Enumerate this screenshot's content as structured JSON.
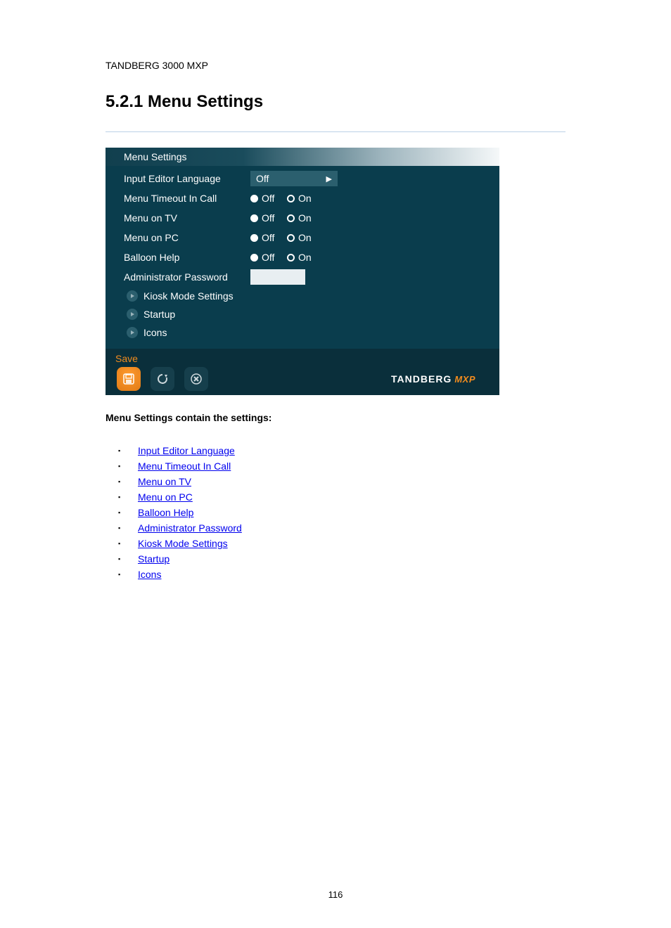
{
  "doc_title": "TANDBERG 3000 MXP",
  "section_heading": "5.2.1 Menu Settings",
  "panel": {
    "title": "Menu Settings",
    "rows": {
      "input_editor": {
        "label": "Input Editor Language",
        "value": "Off"
      },
      "menu_timeout": {
        "label": "Menu Timeout In Call",
        "off": "Off",
        "on": "On"
      },
      "menu_tv": {
        "label": "Menu on TV",
        "off": "Off",
        "on": "On"
      },
      "menu_pc": {
        "label": "Menu on PC",
        "off": "Off",
        "on": "On"
      },
      "balloon": {
        "label": "Balloon Help",
        "off": "Off",
        "on": "On"
      },
      "admin_pw": {
        "label": "Administrator Password"
      }
    },
    "sub_items": {
      "kiosk": "Kiosk Mode Settings",
      "startup": "Startup",
      "icons": "Icons"
    },
    "save_label": "Save",
    "brand": {
      "name": "TANDBERG",
      "suffix": "MXP"
    }
  },
  "links": {
    "subtitle": "Menu Settings contain the settings:",
    "items": [
      "Input Editor Language",
      "Menu Timeout In Call",
      "Menu on TV",
      "Menu on PC",
      "Balloon Help",
      "Administrator Password",
      "Kiosk Mode Settings",
      "Startup",
      "Icons"
    ]
  },
  "page_number": "116"
}
